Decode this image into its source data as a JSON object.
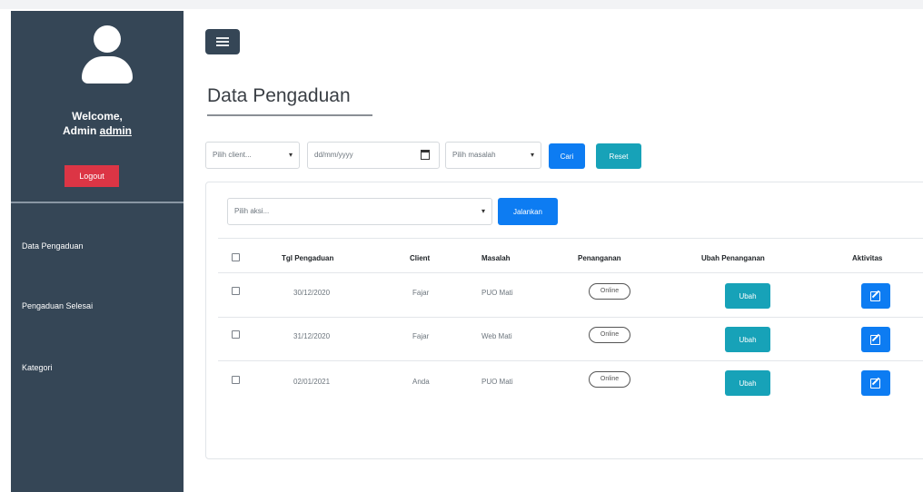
{
  "sidebar": {
    "welcome": "Welcome,",
    "admin_prefix": "Admin ",
    "admin_user": "admin",
    "logout_label": "Logout",
    "menu": [
      "Data Pengaduan",
      "Pengaduan Selesai",
      "Kategori"
    ]
  },
  "page_title": "Data Pengaduan",
  "filters": {
    "client_placeholder": "Pilih client...",
    "date_placeholder": "dd/mm/yyyy",
    "masalah_placeholder": "Pilih masalah",
    "search_label": "Cari",
    "reset_label": "Reset"
  },
  "bulk": {
    "action_placeholder": "Pilih aksi...",
    "run_label": "Jalankan"
  },
  "table": {
    "headers": [
      "Tgl Pengaduan",
      "Client",
      "Masalah",
      "Penanganan",
      "Ubah Penanganan",
      "Aktivitas"
    ],
    "rows": [
      {
        "date": "30/12/2020",
        "client": "Fajar",
        "masalah": "PUO Mati",
        "penanganan": "Online",
        "ubah": "Ubah"
      },
      {
        "date": "31/12/2020",
        "client": "Fajar",
        "masalah": "Web Mati",
        "penanganan": "Online",
        "ubah": "Ubah"
      },
      {
        "date": "02/01/2021",
        "client": "Anda",
        "masalah": "PUO Mati",
        "penanganan": "Online",
        "ubah": "Ubah"
      }
    ]
  },
  "colors": {
    "sidebar_bg": "#354656",
    "danger": "#dc3545",
    "primary": "#0d7cf2",
    "info": "#17a2b8"
  }
}
